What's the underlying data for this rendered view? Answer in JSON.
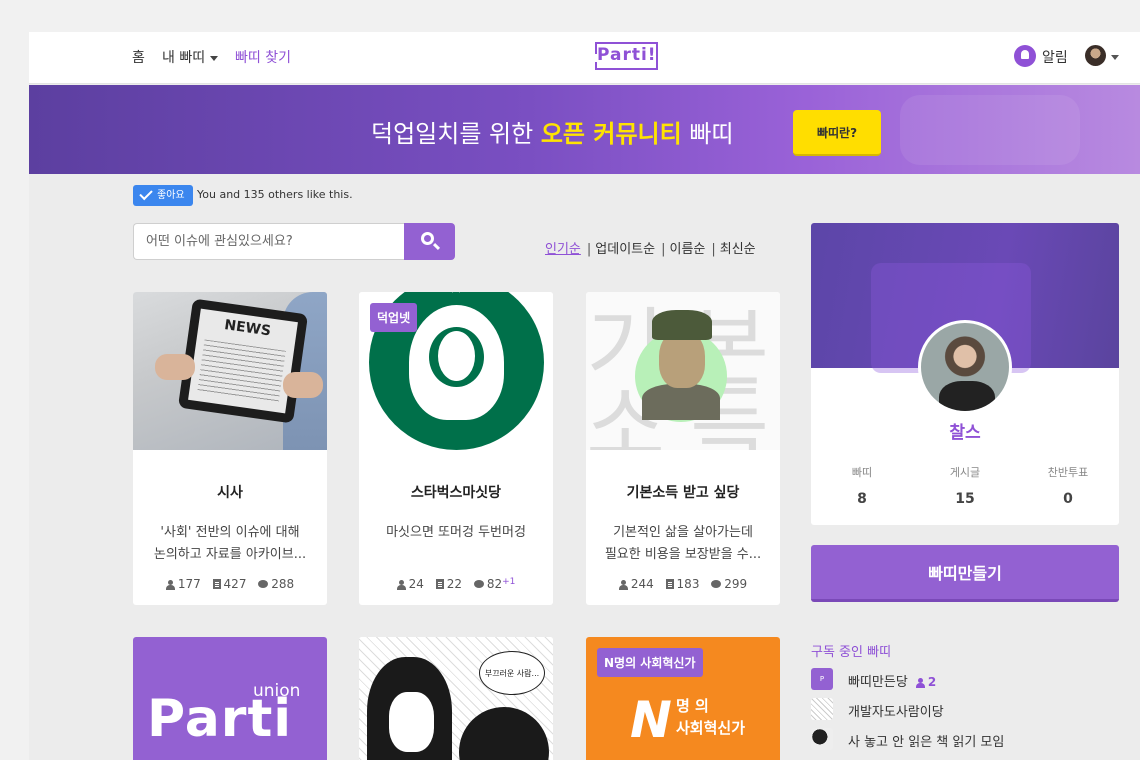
{
  "header": {
    "nav_home": "홈",
    "nav_my": "내 빠띠",
    "nav_find": "빠띠 찾기",
    "logo": "Parti!",
    "alarm_label": "알림"
  },
  "banner": {
    "text_before": "덕업일치를 위한",
    "text_highlight": "오픈 커뮤니티",
    "text_after": "빠띠",
    "button_label": "빠띠란?"
  },
  "like": {
    "button_label": "좋아요",
    "text": "You and 135 others like this."
  },
  "search": {
    "placeholder": "어떤 이슈에 관심있으세요?"
  },
  "sort": [
    "인기순",
    "업데이트순",
    "이름순",
    "최신순"
  ],
  "cards": [
    {
      "title": "시사",
      "desc_line1": "'사회' 전반의 이슈에 대해",
      "desc_line2": "논의하고 자료를 아카이브...",
      "members": "177",
      "posts": "427",
      "comments": "288",
      "comments_new": ""
    },
    {
      "title": "스타벅스마싯당",
      "desc_line1": "마싯으면 또머겅 두번머겅",
      "desc_line2": "",
      "members": "24",
      "posts": "22",
      "comments": "82",
      "comments_new": "+1",
      "tag": "덕업넷"
    },
    {
      "title": "기본소득 받고 싶당",
      "desc_line1": "기본적인 삶을 살아가는데",
      "desc_line2": "필요한 비용을 보장받을 수...",
      "members": "244",
      "posts": "183",
      "comments": "299",
      "comments_new": ""
    }
  ],
  "card_images": {
    "news_title": "NEWS",
    "basic_glyphs": [
      "기",
      "본",
      "소",
      "득"
    ],
    "union_small": "union",
    "union_big": "Parti",
    "comic_bubble": "부끄러운 사람...",
    "orange_tag": "N명의 사회혁신가",
    "orange_logo": "N",
    "orange_line1": "명 의",
    "orange_line2": "사회혁신가"
  },
  "profile": {
    "name": "찰스",
    "stats": [
      {
        "label": "빠띠",
        "value": "8"
      },
      {
        "label": "게시글",
        "value": "15"
      },
      {
        "label": "찬반투표",
        "value": "0"
      }
    ]
  },
  "make_button": "빠띠만들기",
  "subscribed": {
    "title": "구독 중인 빠띠",
    "items": [
      {
        "label": "빠띠만든당",
        "count": "2"
      },
      {
        "label": "개발자도사람이당",
        "count": ""
      },
      {
        "label": "사 놓고 안 읽은 책 읽기 모임",
        "count": ""
      }
    ]
  },
  "colors": {
    "accent": "#8f51d6",
    "banner_highlight": "#ffe300",
    "like_blue": "#3b86ee",
    "orange": "#f5891f"
  }
}
